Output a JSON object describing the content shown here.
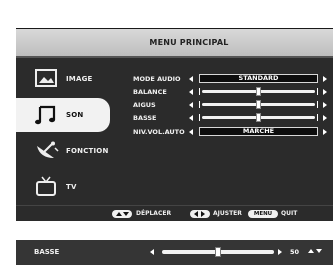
{
  "menu": {
    "title": "MENU PRINCIPAL"
  },
  "sidebar": {
    "items": [
      {
        "label": "IMAGE",
        "icon": "picture-icon",
        "active": false
      },
      {
        "label": "SON",
        "icon": "music-note-icon",
        "active": true
      },
      {
        "label": "FONCTION",
        "icon": "satellite-dish-icon",
        "active": false
      },
      {
        "label": "TV",
        "icon": "tv-icon",
        "active": false
      }
    ]
  },
  "settings": {
    "rows": [
      {
        "label": "MODE AUDIO",
        "type": "select",
        "value": "STANDARD"
      },
      {
        "label": "BALANCE",
        "type": "slider",
        "level": 0.5
      },
      {
        "label": "AIGUS",
        "type": "slider",
        "level": 0.5
      },
      {
        "label": "BASSE",
        "type": "slider",
        "level": 0.5
      },
      {
        "label": "NIV.VOL.AUTO",
        "type": "select",
        "value": "MARCHE"
      }
    ]
  },
  "hints": {
    "move_label": "DÉPLACER",
    "adjust_label": "AJUSTER",
    "menu_key": "MENU",
    "quit_label": "QUIT"
  },
  "bottom": {
    "label": "BASSE",
    "value": "50",
    "level": 0.5
  },
  "colors": {
    "panel": "#2b2b2b",
    "title_bar": "#cfcfcf",
    "highlight": "#f2f2f2"
  }
}
